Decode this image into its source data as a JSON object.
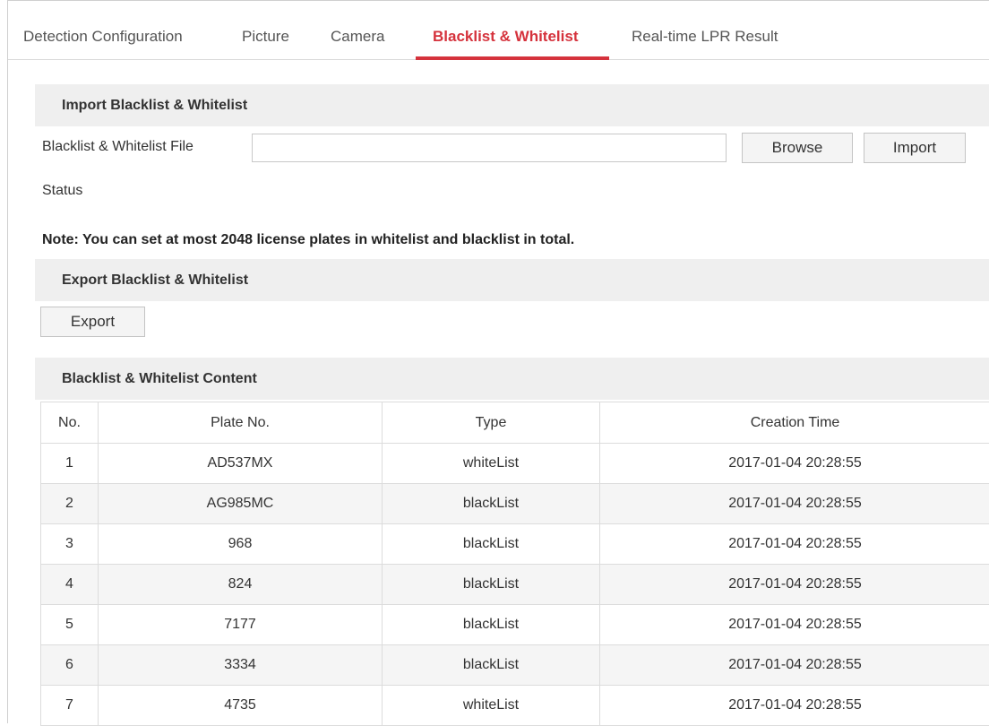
{
  "tabs": [
    {
      "label": "Detection Configuration"
    },
    {
      "label": "Picture"
    },
    {
      "label": "Camera"
    },
    {
      "label": "Blacklist & Whitelist"
    },
    {
      "label": "Real-time LPR Result"
    }
  ],
  "active_tab": "Blacklist & Whitelist",
  "accent_color": "#d5323c",
  "import_section": {
    "title": "Import Blacklist & Whitelist",
    "file_label": "Blacklist & Whitelist File",
    "file_value": "",
    "browse_label": "Browse",
    "import_label": "Import",
    "status_label": "Status"
  },
  "note": "Note: You can set at most 2048 license plates in whitelist and blacklist in total.",
  "export_section": {
    "title": "Export Blacklist & Whitelist",
    "export_label": "Export"
  },
  "content_section": {
    "title": "Blacklist & Whitelist Content",
    "columns": [
      "No.",
      "Plate No.",
      "Type",
      "Creation Time"
    ],
    "rows": [
      [
        "1",
        "AD537MX",
        "whiteList",
        "2017-01-04 20:28:55"
      ],
      [
        "2",
        "AG985MC",
        "blackList",
        "2017-01-04 20:28:55"
      ],
      [
        "3",
        "968",
        "blackList",
        "2017-01-04 20:28:55"
      ],
      [
        "4",
        "824",
        "blackList",
        "2017-01-04 20:28:55"
      ],
      [
        "5",
        "7177",
        "blackList",
        "2017-01-04 20:28:55"
      ],
      [
        "6",
        "3334",
        "blackList",
        "2017-01-04 20:28:55"
      ],
      [
        "7",
        "4735",
        "whiteList",
        "2017-01-04 20:28:55"
      ]
    ]
  }
}
